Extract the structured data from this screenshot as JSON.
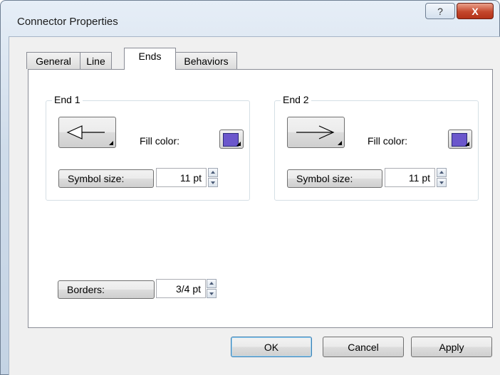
{
  "window": {
    "title": "Connector Properties",
    "help_glyph": "?",
    "close_glyph": "X"
  },
  "tabs": [
    {
      "label": "General",
      "active": false
    },
    {
      "label": "Line",
      "active": false
    },
    {
      "label": "Ends",
      "active": true
    },
    {
      "label": "Behaviors",
      "active": false
    }
  ],
  "end1": {
    "group_label": "End 1",
    "symbol_icon": "arrow-left-open-icon",
    "fill_color_label": "Fill color:",
    "fill_color": "#6b57cc",
    "symbol_size_label": "Symbol size:",
    "symbol_size_value": "11 pt"
  },
  "end2": {
    "group_label": "End 2",
    "symbol_icon": "arrow-right-open-icon",
    "fill_color_label": "Fill color:",
    "fill_color": "#6b57cc",
    "symbol_size_label": "Symbol size:",
    "symbol_size_value": "11 pt"
  },
  "borders": {
    "label": "Borders:",
    "value": "3/4 pt"
  },
  "footer": {
    "ok_label": "OK",
    "cancel_label": "Cancel",
    "apply_label": "Apply"
  }
}
